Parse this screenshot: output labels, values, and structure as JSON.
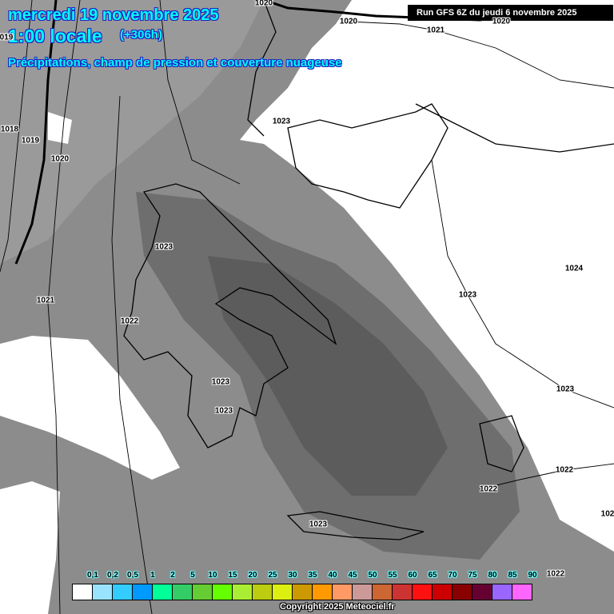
{
  "header": {
    "date": "mercredi 19 novembre 2025",
    "hour": "1:00 locale",
    "lead_time": "(+306h)",
    "subtitle": "Précipitations, champ de pression et couverture nuageuse",
    "run": "Run GFS 6Z du jeudi 6 novembre 2025"
  },
  "isobar_labels": [
    "1020",
    "1020",
    "1021",
    "1020",
    "1023",
    "1018",
    "1019",
    "1020",
    "1023",
    "1024",
    "1023",
    "1021",
    "1022",
    "1023",
    "1023",
    "1023",
    "1022",
    "1022",
    "1023",
    "1022",
    "102",
    "019"
  ],
  "legend": {
    "labels": [
      "0,1",
      "0,2",
      "0,5",
      "1",
      "2",
      "5",
      "10",
      "15",
      "20",
      "25",
      "30",
      "35",
      "40",
      "45",
      "50",
      "55",
      "60",
      "65",
      "70",
      "75",
      "80",
      "85",
      "90"
    ],
    "colors": [
      "#ffffff",
      "#99e3ff",
      "#33ccff",
      "#0099ff",
      "#00ff99",
      "#33cc66",
      "#66cc33",
      "#66ff00",
      "#aaee33",
      "#bbcc11",
      "#ddee11",
      "#cc9900",
      "#ff9900",
      "#ff9966",
      "#cc9999",
      "#cc6633",
      "#cc3333",
      "#ff1111",
      "#cc0000",
      "#880000",
      "#660033",
      "#9966ff",
      "#ff66ff"
    ]
  },
  "copyright": "Copyright 2025 Meteociel.fr"
}
